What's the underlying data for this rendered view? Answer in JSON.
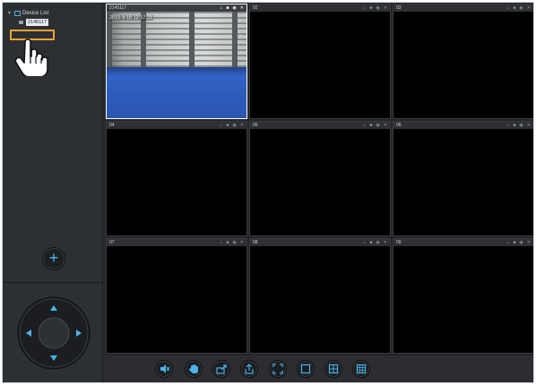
{
  "sidebar": {
    "tree": {
      "root_label": "Device List",
      "device_label": "2145117"
    }
  },
  "colors": {
    "accent": "#4ab3ec",
    "highlight": "#f0a431",
    "video_floor": "#2c5bbb"
  },
  "icons": {
    "hand": "pointing-hand-icon",
    "add": "plus-icon",
    "ptz": [
      "arrow-up-icon",
      "arrow-down-icon",
      "arrow-left-icon",
      "arrow-right-icon"
    ]
  },
  "grid": {
    "tiles": [
      {
        "id": "tile-1",
        "title": "2145117",
        "selected": true,
        "has_video": true,
        "timestamp": "2015-9-18  12:17:25"
      },
      {
        "id": "tile-2",
        "title": "02",
        "selected": false,
        "has_video": false
      },
      {
        "id": "tile-3",
        "title": "03",
        "selected": false,
        "has_video": false
      },
      {
        "id": "tile-4",
        "title": "04",
        "selected": false,
        "has_video": false
      },
      {
        "id": "tile-5",
        "title": "05",
        "selected": false,
        "has_video": false
      },
      {
        "id": "tile-6",
        "title": "06",
        "selected": false,
        "has_video": false
      },
      {
        "id": "tile-7",
        "title": "07",
        "selected": false,
        "has_video": false
      },
      {
        "id": "tile-8",
        "title": "08",
        "selected": false,
        "has_video": false
      },
      {
        "id": "tile-9",
        "title": "09",
        "selected": false,
        "has_video": false
      }
    ],
    "tile_tools": [
      "microphone-icon",
      "record-icon",
      "snapshot-icon",
      "close-icon"
    ]
  },
  "toolbar": {
    "buttons": [
      "mute-icon",
      "hand-stop-icon",
      "export-icon",
      "import-icon",
      "fullscreen-icon",
      "layout-1-icon",
      "layout-4-icon",
      "layout-9-icon"
    ]
  }
}
